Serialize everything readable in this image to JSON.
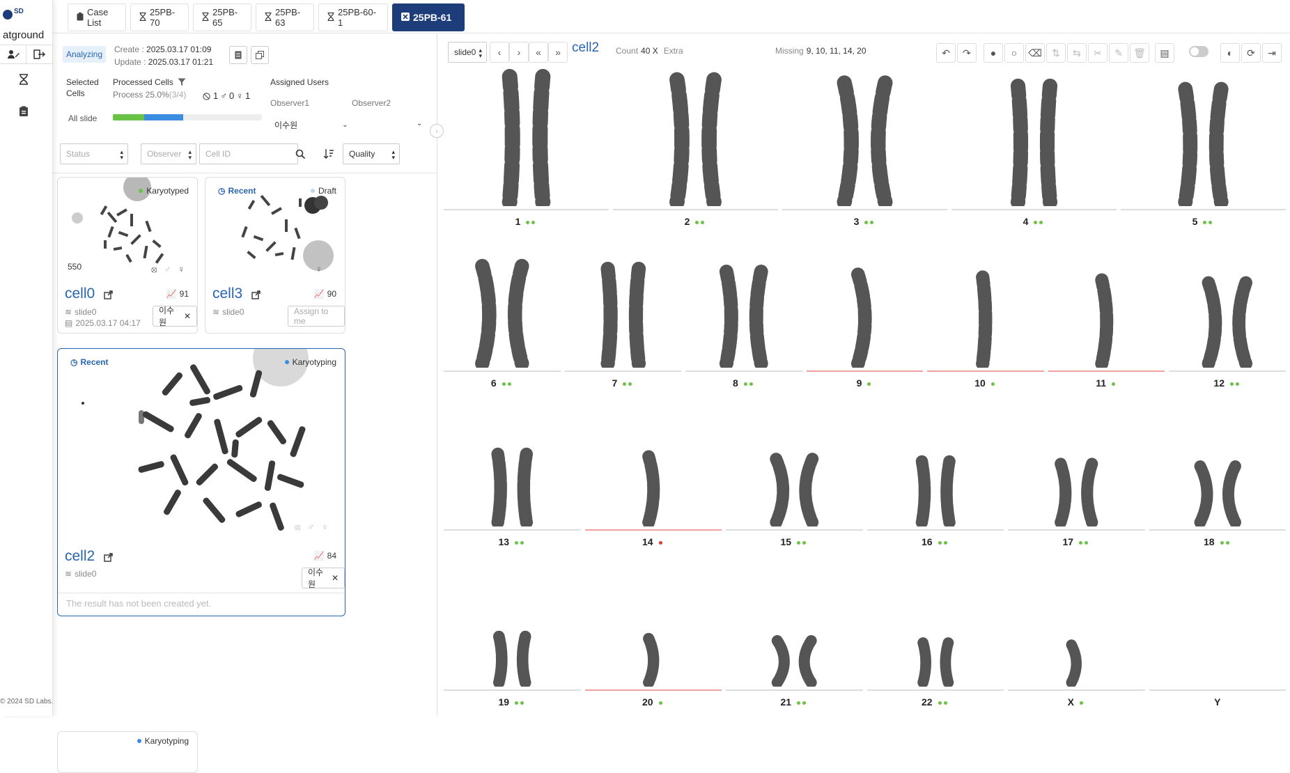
{
  "app": {
    "name": "atground",
    "copyright": "© 2024 SD Labs.",
    "logo_text": "SD"
  },
  "tabs": [
    {
      "label": "Case List",
      "icon": "clipboard-icon",
      "active": false
    },
    {
      "label": "25PB-70",
      "icon": "hourglass-icon",
      "active": false
    },
    {
      "label": "25PB-65",
      "icon": "hourglass-icon",
      "active": false
    },
    {
      "label": "25PB-63",
      "icon": "hourglass-icon",
      "active": false
    },
    {
      "label": "25PB-60-1",
      "icon": "hourglass-icon",
      "active": false
    },
    {
      "label": "25PB-61",
      "icon": "close-icon",
      "active": true
    }
  ],
  "case": {
    "status": "Analyzing",
    "create_label": "Create :",
    "create_value": "2025.03.17 01:09",
    "update_label": "Update :",
    "update_value": "2025.03.17 01:21",
    "selected_cells_label": "Selected Cells",
    "selected_cells_value": "All slide",
    "processed_cells_label": "Processed Cells",
    "process_label": "Process 25.0%",
    "process_fraction": "(3/4)",
    "progress_green": 0.21,
    "progress_blue": 0.47,
    "counts": {
      "unknown": "1",
      "male": "0",
      "female": "1"
    },
    "assigned_users_label": "Assigned Users",
    "observer1_label": "Observer1",
    "observer2_label": "Observer2",
    "observer1_value": "이수원"
  },
  "filters": {
    "status_placeholder": "Status",
    "observer_placeholder": "Observer",
    "cellid_placeholder": "Cell ID",
    "sort_value": "Quality"
  },
  "cards": [
    {
      "name": "cell0",
      "status": "Karyotyped",
      "status_color": "#6ac246",
      "recent": false,
      "count_label": "550",
      "score": "91",
      "slide": "slide0",
      "date": "2025.03.17 04:17",
      "user": "이수원"
    },
    {
      "name": "cell3",
      "status": "Draft",
      "status_color": "#bcd7f0",
      "recent": true,
      "recent_label": "Recent",
      "score": "90",
      "slide": "slide0",
      "assign_label": "Assign to me"
    },
    {
      "name": "cell2",
      "status": "Karyotyping",
      "status_color": "#3a8de0",
      "recent": true,
      "recent_label": "Recent",
      "score": "84",
      "slide": "slide0",
      "user": "이수원",
      "result_text": "The result has not been created yet."
    },
    {
      "status": "Karyotyping",
      "status_color": "#3a8de0"
    }
  ],
  "viewer": {
    "slide_select": "slide0",
    "cell_name": "cell2",
    "count_label": "Count",
    "count_value": "40 X",
    "extra_label": "Extra",
    "missing_label": "Missing",
    "missing_value": "9, 10, 11, 14, 20"
  },
  "chromosomes": [
    {
      "label": "1",
      "dots": 2,
      "missing": false
    },
    {
      "label": "2",
      "dots": 2,
      "missing": false
    },
    {
      "label": "3",
      "dots": 2,
      "missing": false
    },
    {
      "label": "4",
      "dots": 2,
      "missing": false
    },
    {
      "label": "5",
      "dots": 2,
      "missing": false
    },
    {
      "label": "6",
      "dots": 2,
      "missing": false
    },
    {
      "label": "7",
      "dots": 2,
      "missing": false
    },
    {
      "label": "8",
      "dots": 2,
      "missing": false
    },
    {
      "label": "9",
      "dots": 1,
      "missing": true
    },
    {
      "label": "10",
      "dots": 1,
      "missing": true
    },
    {
      "label": "11",
      "dots": 1,
      "missing": true
    },
    {
      "label": "12",
      "dots": 2,
      "missing": false
    },
    {
      "label": "13",
      "dots": 2,
      "missing": false
    },
    {
      "label": "14",
      "dots": 1,
      "missing": true,
      "red": true
    },
    {
      "label": "15",
      "dots": 2,
      "missing": false
    },
    {
      "label": "16",
      "dots": 2,
      "missing": false
    },
    {
      "label": "17",
      "dots": 2,
      "missing": false
    },
    {
      "label": "18",
      "dots": 2,
      "missing": false
    },
    {
      "label": "19",
      "dots": 2,
      "missing": false
    },
    {
      "label": "20",
      "dots": 1,
      "missing": true
    },
    {
      "label": "21",
      "dots": 2,
      "missing": false
    },
    {
      "label": "22",
      "dots": 2,
      "missing": false
    },
    {
      "label": "X",
      "dots": 1,
      "missing": false
    },
    {
      "label": "Y",
      "dots": 0,
      "missing": false
    }
  ],
  "colors": {
    "brand": "#1c3d7a",
    "link": "#2a65b0",
    "ok": "#6ac246",
    "missing": "#e53935"
  }
}
